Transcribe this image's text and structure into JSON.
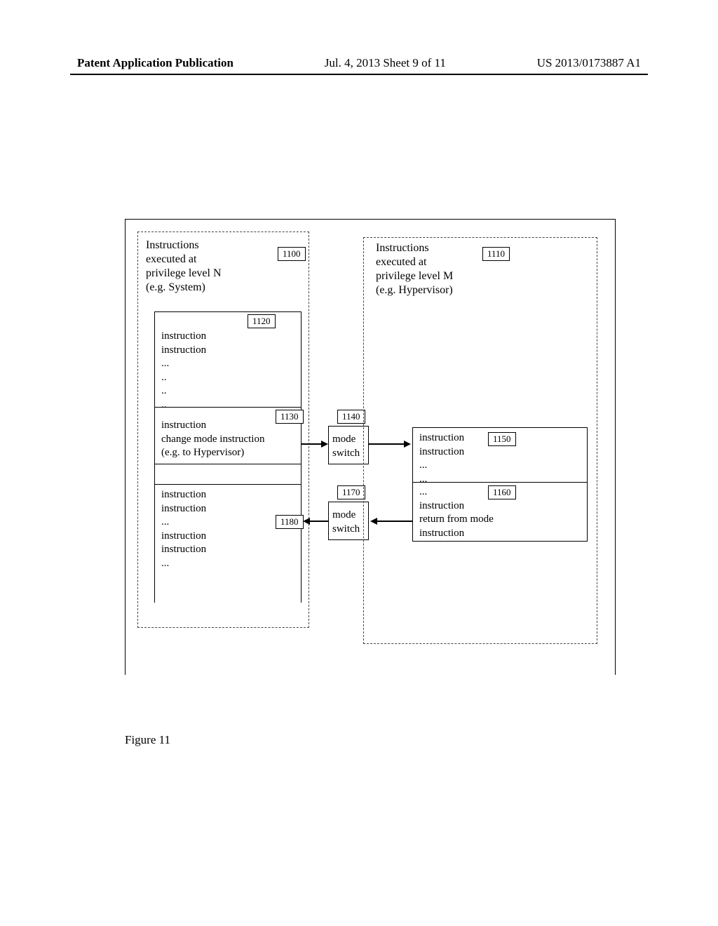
{
  "header": {
    "left": "Patent Application Publication",
    "mid": "Jul. 4, 2013   Sheet 9 of 11",
    "right": "US 2013/0173887 A1"
  },
  "figure_caption": "Figure 11",
  "left_group": {
    "title": "Instructions\nexecuted at\nprivilege level N\n(e.g. System)",
    "ref": "1100"
  },
  "right_group": {
    "title": "Instructions\nexecuted at\nprivilege level M\n(e.g. Hypervisor)",
    "ref": "1110"
  },
  "box1120": {
    "ref": "1120",
    "text": "instruction\ninstruction\n...\n..\n..\n.."
  },
  "box1130": {
    "ref": "1130",
    "text": "instruction\nchange mode instruction\n(e.g. to Hypervisor)"
  },
  "box1140": {
    "ref": "1140",
    "text": "mode\nswitch"
  },
  "box1150": {
    "ref": "1150",
    "text": "instruction\ninstruction\n...\n..."
  },
  "box1160": {
    "ref": "1160",
    "text": "...\ninstruction\nreturn from mode\ninstruction"
  },
  "box1170": {
    "ref": "1170",
    "text": "mode\nswitch"
  },
  "box1180": {
    "ref": "1180",
    "text": "instruction\ninstruction\n...\ninstruction\ninstruction\n..."
  }
}
